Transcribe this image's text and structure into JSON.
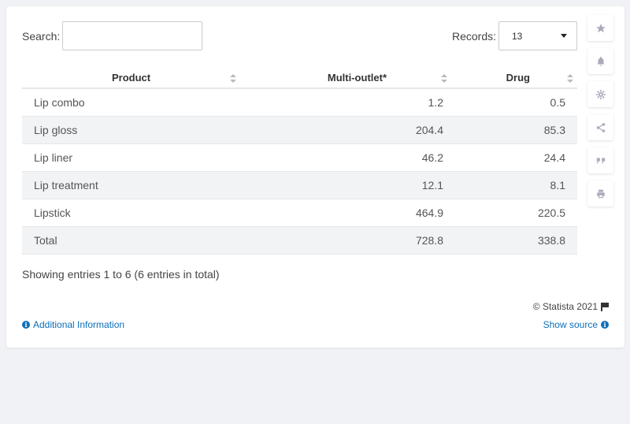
{
  "search": {
    "label": "Search:",
    "value": "",
    "placeholder": ""
  },
  "records": {
    "label": "Records:",
    "value": "13"
  },
  "table": {
    "headers": [
      "Product",
      "Multi-outlet*",
      "Drug"
    ],
    "rows": [
      [
        "Lip combo",
        "1.2",
        "0.5"
      ],
      [
        "Lip gloss",
        "204.4",
        "85.3"
      ],
      [
        "Lip liner",
        "46.2",
        "24.4"
      ],
      [
        "Lip treatment",
        "12.1",
        "8.1"
      ],
      [
        "Lipstick",
        "464.9",
        "220.5"
      ],
      [
        "Total",
        "728.8",
        "338.8"
      ]
    ]
  },
  "info": "Showing entries 1 to 6 (6 entries in total)",
  "footer": {
    "copyright": "© Statista 2021",
    "additional_info": "Additional Information",
    "show_source": "Show source"
  },
  "sidebar_icons": [
    "star-icon",
    "bell-icon",
    "gear-icon",
    "share-icon",
    "quote-icon",
    "print-icon"
  ],
  "colors": {
    "link": "#0d6fb8",
    "alt_row": "#f1f3f5",
    "icon": "#aab"
  }
}
